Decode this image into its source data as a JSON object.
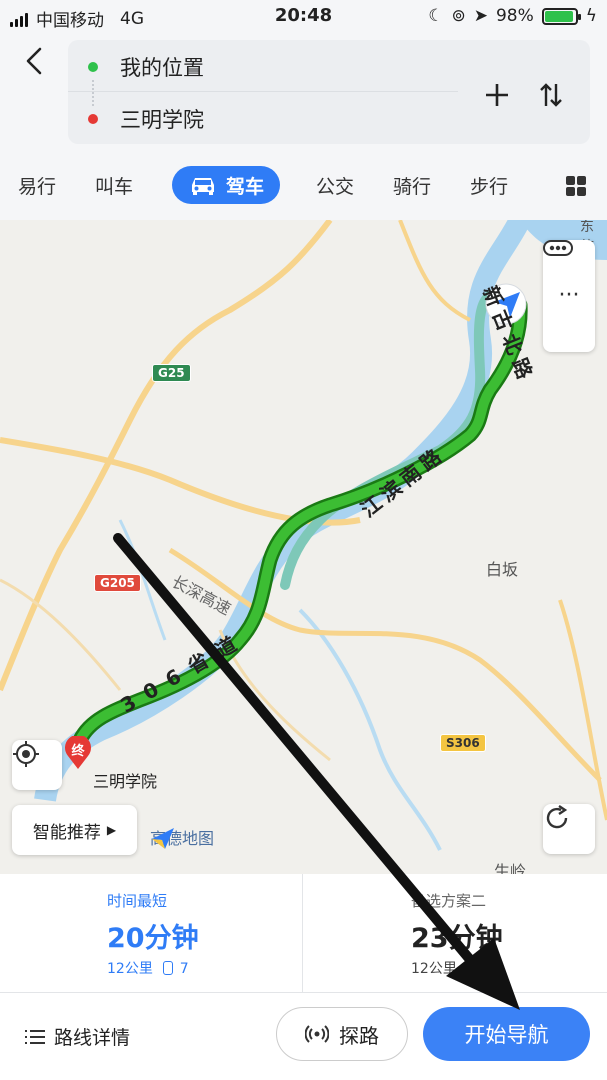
{
  "status_bar": {
    "carrier": "中国移动",
    "network": "4G",
    "time": "20:48",
    "battery": "98%"
  },
  "header": {
    "start": "我的位置",
    "end": "三明学院"
  },
  "tabs": {
    "items": [
      "易行",
      "叫车",
      "公交",
      "骑行",
      "步行"
    ],
    "active": "驾车"
  },
  "map": {
    "roads": {
      "xingubei": "新古北路",
      "jiangbinnan": "江滨南路",
      "s306_road": "306省道",
      "changshen": "长深高速"
    },
    "shields": {
      "g25": "G25",
      "g205": "G205",
      "s306": "S306"
    },
    "places": {
      "baiban": "白坂",
      "shengling": "生岭",
      "top_right": "东乾",
      "destination": "三明学院"
    },
    "end_marker": "终",
    "smart_recommend": "智能推荐",
    "logo": "高德地图"
  },
  "plans": [
    {
      "title": "时间最短",
      "time": "20分钟",
      "distance": "12公里",
      "lights": "7"
    },
    {
      "title": "备选方案二",
      "time": "23分钟",
      "distance": "12公里"
    }
  ],
  "actions": {
    "details": "路线详情",
    "explore": "探路",
    "start_nav": "开始导航"
  },
  "colors": {
    "accent": "#2f7cf6",
    "route": "#2fa82b",
    "start_dot": "#2ec14b",
    "end_dot": "#e53935"
  }
}
